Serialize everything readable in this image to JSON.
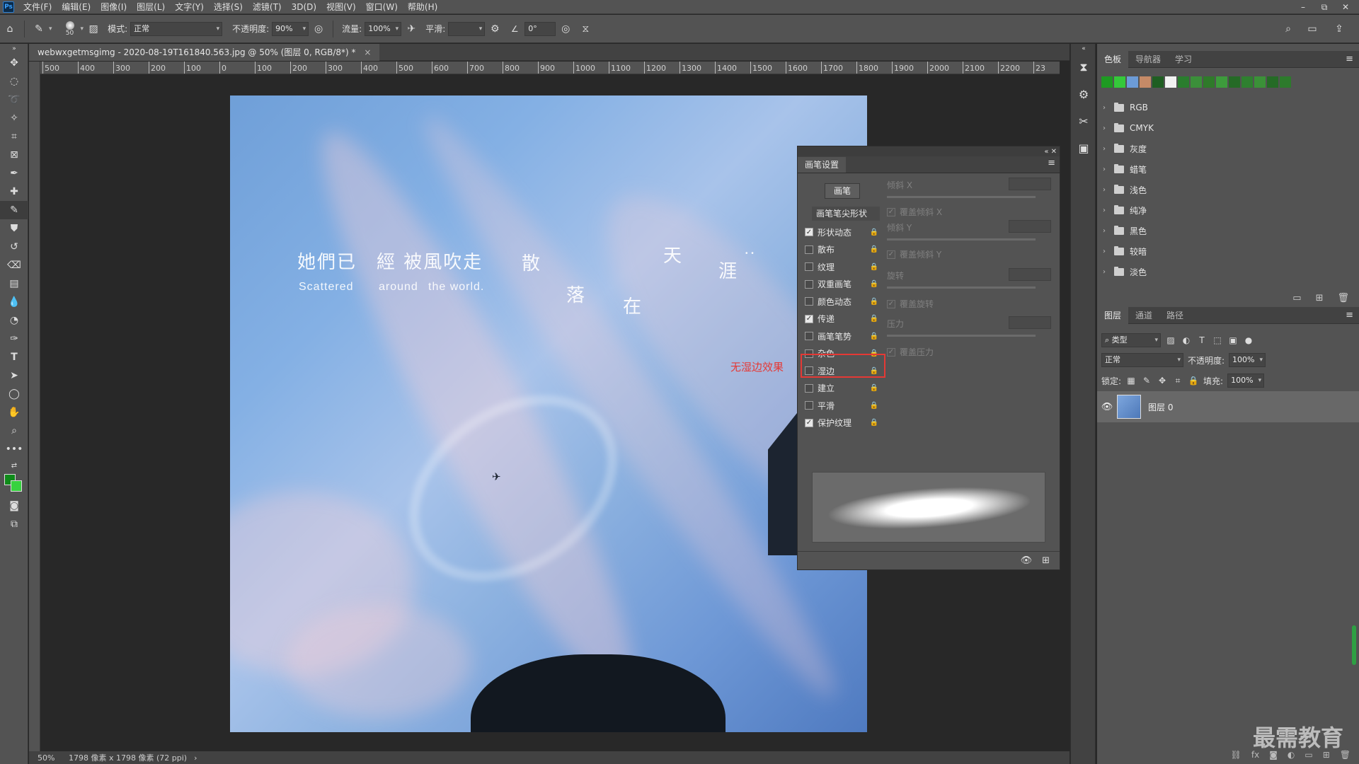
{
  "menubar": {
    "logo": "Ps",
    "items": [
      "文件(F)",
      "编辑(E)",
      "图像(I)",
      "图层(L)",
      "文字(Y)",
      "选择(S)",
      "滤镜(T)",
      "3D(D)",
      "视图(V)",
      "窗口(W)",
      "帮助(H)"
    ],
    "win_min": "–",
    "win_restore": "⧉",
    "win_close": "✕"
  },
  "options": {
    "brush_size": "50",
    "mode_label": "模式:",
    "mode_value": "正常",
    "opacity_label": "不透明度:",
    "opacity_value": "90%",
    "flow_label": "流量:",
    "flow_value": "100%",
    "smooth_label": "平滑:",
    "smooth_value": "",
    "angle_value": "0°"
  },
  "document": {
    "tab_title": "webwxgetmsgimg - 2020-08-19T161840.563.jpg @ 50% (图层 0, RGB/8*) *",
    "tab_close": "×"
  },
  "ruler": {
    "h_ticks": [
      "500",
      "400",
      "300",
      "200",
      "100",
      "0",
      "100",
      "200",
      "300",
      "400",
      "500",
      "600",
      "700",
      "800",
      "900",
      "1000",
      "1100",
      "1200",
      "1300",
      "1400",
      "1500",
      "1600",
      "1700",
      "1800",
      "1900",
      "2000",
      "2100",
      "2200",
      "23"
    ]
  },
  "photo": {
    "line1": "她們已　經  被風吹走",
    "sub1": "Scattered",
    "sub2": "around",
    "sub3": "the world.",
    "c1": "散",
    "c2": "落",
    "c3": "在",
    "c4": "天",
    "c5": "涯",
    "dots": "• •"
  },
  "annotation": "无湿边效果",
  "status": {
    "zoom": "50%",
    "info": "1798 像素 x 1798 像素 (72 ppi)",
    "arrow": "›"
  },
  "brush_panel": {
    "title_controls": "«  ✕",
    "tab": "画笔设置",
    "menu": "≡",
    "preset_button": "画笔",
    "tip_shape": "画笔笔尖形状",
    "options": [
      {
        "label": "形状动态",
        "checked": true
      },
      {
        "label": "散布",
        "checked": false
      },
      {
        "label": "纹理",
        "checked": false
      },
      {
        "label": "双重画笔",
        "checked": false
      },
      {
        "label": "颜色动态",
        "checked": false
      },
      {
        "label": "传递",
        "checked": true
      },
      {
        "label": "画笔笔势",
        "checked": false
      },
      {
        "label": "杂色",
        "checked": false
      },
      {
        "label": "湿边",
        "checked": false
      },
      {
        "label": "建立",
        "checked": false
      },
      {
        "label": "平滑",
        "checked": false
      },
      {
        "label": "保护纹理",
        "checked": true
      }
    ],
    "right": {
      "tilt_x": "倾斜 X",
      "override_tilt_x": "覆盖倾斜 X",
      "tilt_y": "倾斜 Y",
      "override_tilt_y": "覆盖倾斜 Y",
      "rotation": "旋转",
      "override_rotation": "覆盖旋转",
      "pressure": "压力",
      "override_pressure": "覆盖压力"
    }
  },
  "mid_strip_icons": [
    "history-icon",
    "properties-icon",
    "brush-settings-icon",
    "library-icon"
  ],
  "swatches": {
    "tabs": [
      "色板",
      "导航器",
      "学习"
    ],
    "colors": [
      "#1e9a22",
      "#35c83a",
      "#6c9bd6",
      "#c58a67",
      "#1f5e22",
      "#f2f2f2",
      "#2a7d2e",
      "#3b8f3a",
      "#2f7a2a",
      "#3d9b3c",
      "#256a26",
      "#2f8030",
      "#3b9138",
      "#256b26",
      "#2d7a2c"
    ],
    "groups": [
      "RGB",
      "CMYK",
      "灰度",
      "蜡笔",
      "浅色",
      "纯净",
      "黑色",
      "较暗",
      "淡色"
    ]
  },
  "layers": {
    "tabs": [
      "图层",
      "通道",
      "路径"
    ],
    "filter_label": "类型",
    "blend_mode": "正常",
    "opacity_label": "不透明度:",
    "opacity_value": "100%",
    "lock_label": "锁定:",
    "fill_label": "填充:",
    "fill_value": "100%",
    "layer_name": "图层 0"
  },
  "watermark": "最需教育"
}
